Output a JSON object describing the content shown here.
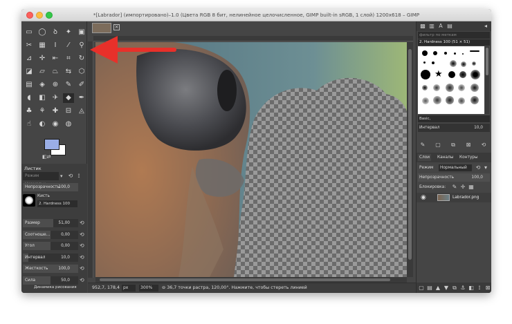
{
  "window": {
    "title": "*[Labrador] (импортировано)–1.0 (Цвета RGB 8 бит, нелинейное целочисленное, GIMP built-in sRGB, 1 слой) 1200x618 – GIMP"
  },
  "tool_options": {
    "title": "Листик",
    "mode_value": "Режим Нормальн...",
    "opacity_label": "Непрозрачность",
    "opacity_value": "100,0",
    "opacity_fraction": 1.0,
    "brush_label": "Кисть",
    "brush_name": "2. Hardness 100",
    "sliders": [
      {
        "label": "Размер",
        "value": "51,00",
        "fraction": 0.55
      },
      {
        "label": "Соотноше...",
        "value": "0,00",
        "fraction": 0.5
      },
      {
        "label": "Угол",
        "value": "0,00",
        "fraction": 0.5
      },
      {
        "label": "Интервал",
        "value": "10,0",
        "fraction": 0.1
      },
      {
        "label": "Жесткость",
        "value": "100,0",
        "fraction": 1.0
      },
      {
        "label": "Сила",
        "value": "50,0",
        "fraction": 0.5
      }
    ],
    "dynamics_label": "Динамика рисования",
    "dynamics_value": "Dynamics Off"
  },
  "status": {
    "coords": "952,7, 178,4",
    "unit": "px",
    "zoom": "300%",
    "message": "⊖ 36,7 точки растра, 120,00°. Нажмите, чтобы стереть линией"
  },
  "brushes_dock": {
    "filter_placeholder": "фильтр по меткам",
    "selected_brush": "2. Hardness 100 (51 × 51)",
    "preset_field": "Basic,",
    "interval_label": "Интервал",
    "interval_value": "10,0"
  },
  "layers_dock": {
    "tabs": [
      "Слои",
      "Каналы",
      "Контуры"
    ],
    "mode_label": "Режим",
    "mode_value": "Нормальный",
    "opacity_label": "Непрозрачность",
    "opacity_value": "100,0",
    "lock_label": "Блокировка:",
    "layer_name": "Labrador.png"
  },
  "colors": {
    "foreground": "#9aaee6",
    "background": "#ffffff",
    "annotation_arrow": "#e8302a"
  }
}
